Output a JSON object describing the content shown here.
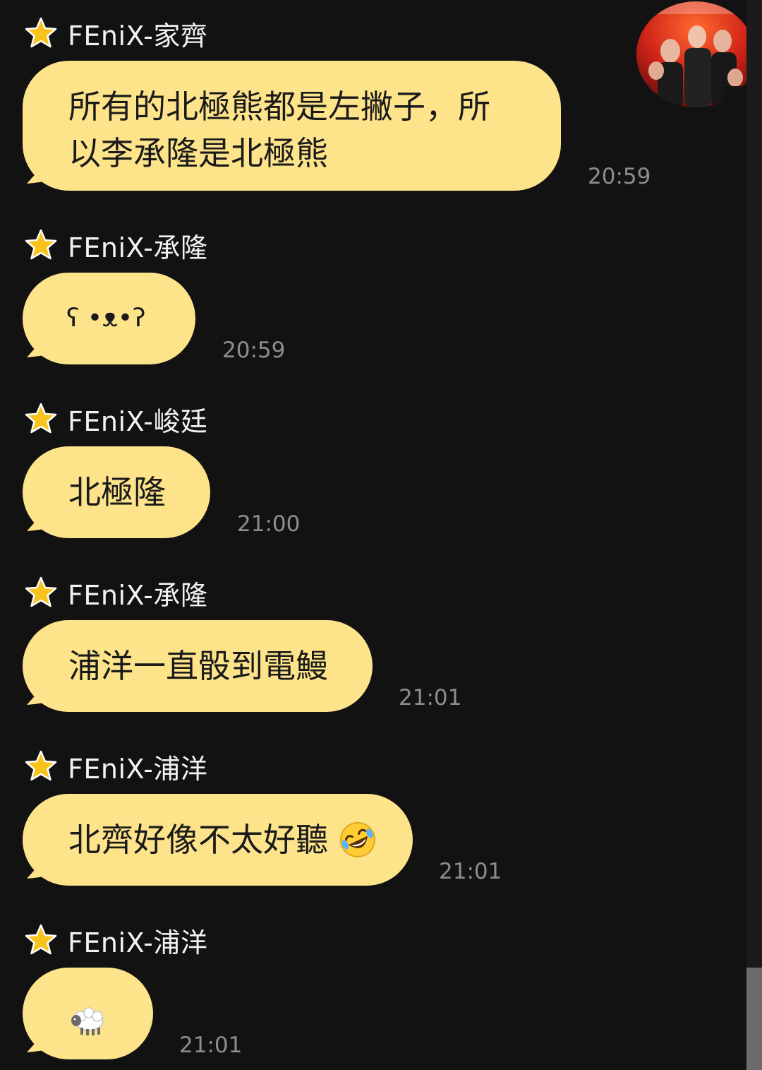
{
  "colors": {
    "background": "#121212",
    "bubble": "#fde38a",
    "star": "#f7c31c",
    "time": "#8d8d8d",
    "name": "#f2f2f2"
  },
  "messages": [
    {
      "sender": "FEniX-家齊",
      "lines": [
        "所有的北極熊都是左撇子，所",
        "以李承隆是北極熊"
      ],
      "time": "20:59"
    },
    {
      "sender": "FEniX-承隆",
      "text": "ʕ •ᴥ•ʔ",
      "time": "20:59"
    },
    {
      "sender": "FEniX-峻廷",
      "text": "北極隆",
      "time": "21:00"
    },
    {
      "sender": "FEniX-承隆",
      "text": "浦洋一直骰到電鰻",
      "time": "21:01"
    },
    {
      "sender": "FEniX-浦洋",
      "text": "北齊好像不太好聽",
      "emoji": "rolling-on-floor-laughing-emoji",
      "time": "21:01"
    },
    {
      "sender": "FEniX-浦洋",
      "emoji": "sheep-emoji",
      "time": "21:01"
    }
  ]
}
